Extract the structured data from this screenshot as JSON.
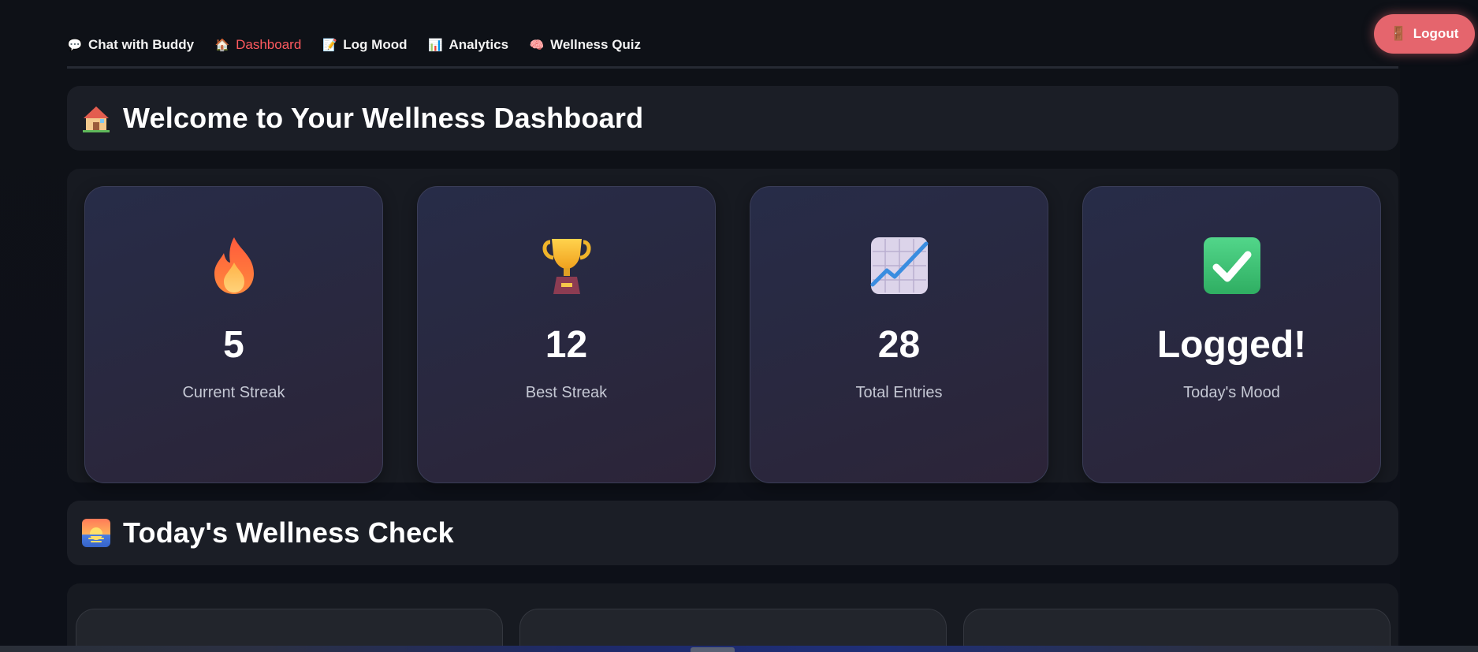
{
  "nav": {
    "items": [
      {
        "icon": "speech-balloon-icon",
        "glyph": "💬",
        "label": "Chat with Buddy",
        "active": false
      },
      {
        "icon": "house-icon",
        "glyph": "🏠",
        "label": "Dashboard",
        "active": true
      },
      {
        "icon": "memo-icon",
        "glyph": "📝",
        "label": "Log Mood",
        "active": false
      },
      {
        "icon": "bar-chart-icon",
        "glyph": "📊",
        "label": "Analytics",
        "active": false
      },
      {
        "icon": "brain-icon",
        "glyph": "🧠",
        "label": "Wellness Quiz",
        "active": false
      }
    ],
    "active_color": "#ff5a5f"
  },
  "logout": {
    "icon": "door-icon",
    "glyph": "🚪",
    "label": "Logout",
    "color": "#e5656d"
  },
  "welcome": {
    "icon": "house-icon",
    "glyph": "🏠",
    "title": "Welcome to Your Wellness Dashboard"
  },
  "metrics": [
    {
      "icon": "fire-icon",
      "value": "5",
      "label": "Current Streak"
    },
    {
      "icon": "trophy-icon",
      "value": "12",
      "label": "Best Streak"
    },
    {
      "icon": "chart-increasing-icon",
      "value": "28",
      "label": "Total Entries"
    },
    {
      "icon": "check-mark-icon",
      "value": "Logged!",
      "label": "Today's Mood"
    }
  ],
  "wellness_check": {
    "icon": "sunrise-icon",
    "title": "Today's Wellness Check"
  }
}
